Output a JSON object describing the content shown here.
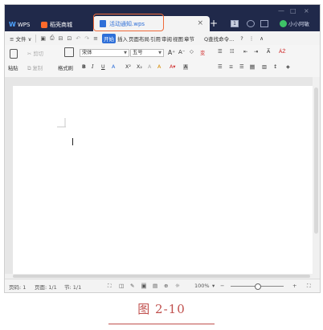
{
  "titlebar": {
    "wps_label": "WPS",
    "shop_label": "稻壳商城",
    "doc_tab_title": "活动通知.wps",
    "tab_close": "×",
    "new_tab": "+",
    "badge_number": "1",
    "user_label": "小小阿敏",
    "window_controls": [
      "—",
      "□",
      "×"
    ]
  },
  "menubar": {
    "file": "≡ 文件 ∨",
    "start": "开始",
    "items": [
      "插入",
      "页面布局",
      "引用",
      "审阅",
      "视图",
      "章节"
    ],
    "find": "Q查找命令...",
    "help": "?",
    "more": "⋮",
    "collapse": "∧"
  },
  "ribbon": {
    "paste": "粘贴",
    "cut": "剪切",
    "copy": "复制",
    "format_painter": "格式刷",
    "font_name": "宋体",
    "font_size": "五号",
    "bold": "B",
    "italic": "I",
    "underline": "U",
    "font_color": "A",
    "superscript": "X²",
    "subscript": "X₂",
    "highlight": "A",
    "grow_font": "A⁺",
    "shrink_font": "A⁻",
    "clear_format": "◇",
    "phonetic": "变",
    "list_bullets": "☰",
    "sort": "ȦŻ",
    "charset": "A"
  },
  "statusbar": {
    "page_num": "页码: 1",
    "page_total": "页面: 1/1",
    "section": "节: 1/1",
    "zoom": "100%",
    "zoom_minus": "−",
    "zoom_plus": "+"
  },
  "caption": {
    "text": "图 2-10"
  },
  "colors": {
    "titlebar_bg": "#20294a",
    "accent_blue": "#2e6fd8",
    "highlight_box": "#ef6a3a",
    "caption_red": "#c0504d"
  }
}
